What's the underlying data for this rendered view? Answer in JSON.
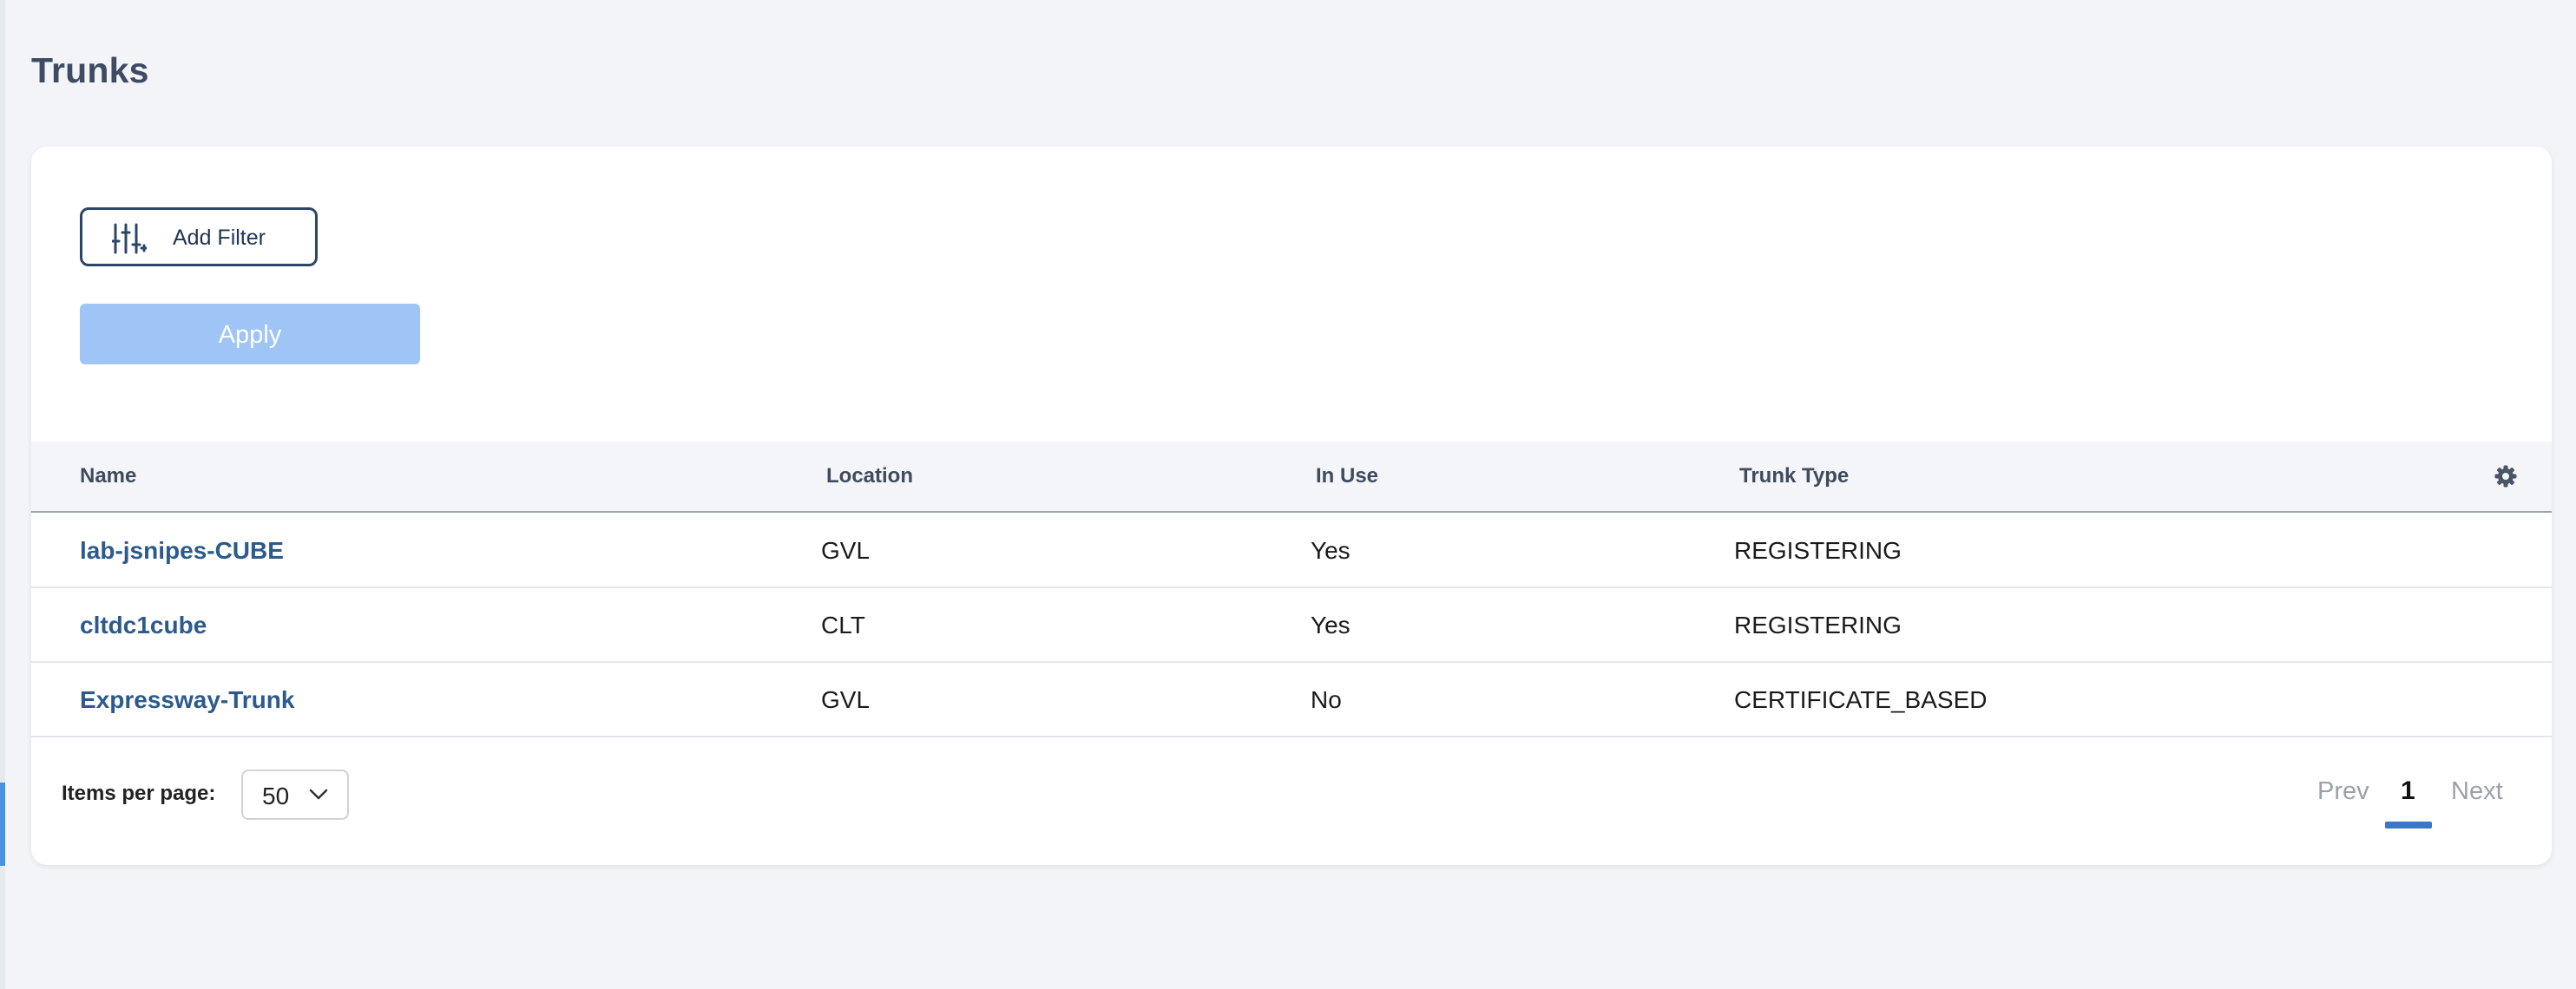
{
  "page": {
    "title": "Trunks"
  },
  "filters": {
    "add_filter_label": "Add Filter",
    "add_filter_icon": "sliders-icon",
    "apply_label": "Apply"
  },
  "table": {
    "columns": [
      "Name",
      "Location",
      "In Use",
      "Trunk Type"
    ],
    "settings_icon": "gear-icon",
    "rows": [
      {
        "name": "lab-jsnipes-CUBE",
        "location": "GVL",
        "in_use": "Yes",
        "trunk_type": "REGISTERING"
      },
      {
        "name": "cltdc1cube",
        "location": "CLT",
        "in_use": "Yes",
        "trunk_type": "REGISTERING"
      },
      {
        "name": "Expressway-Trunk",
        "location": "GVL",
        "in_use": "No",
        "trunk_type": "CERTIFICATE_BASED"
      }
    ]
  },
  "pagination": {
    "items_per_page_label": "Items per page:",
    "items_per_page_value": "50",
    "prev_label": "Prev",
    "current_page": "1",
    "next_label": "Next"
  },
  "colors": {
    "link": "#2d5a8c",
    "apply_disabled": "#9fc5f7",
    "page_accent": "#3a77c4"
  }
}
